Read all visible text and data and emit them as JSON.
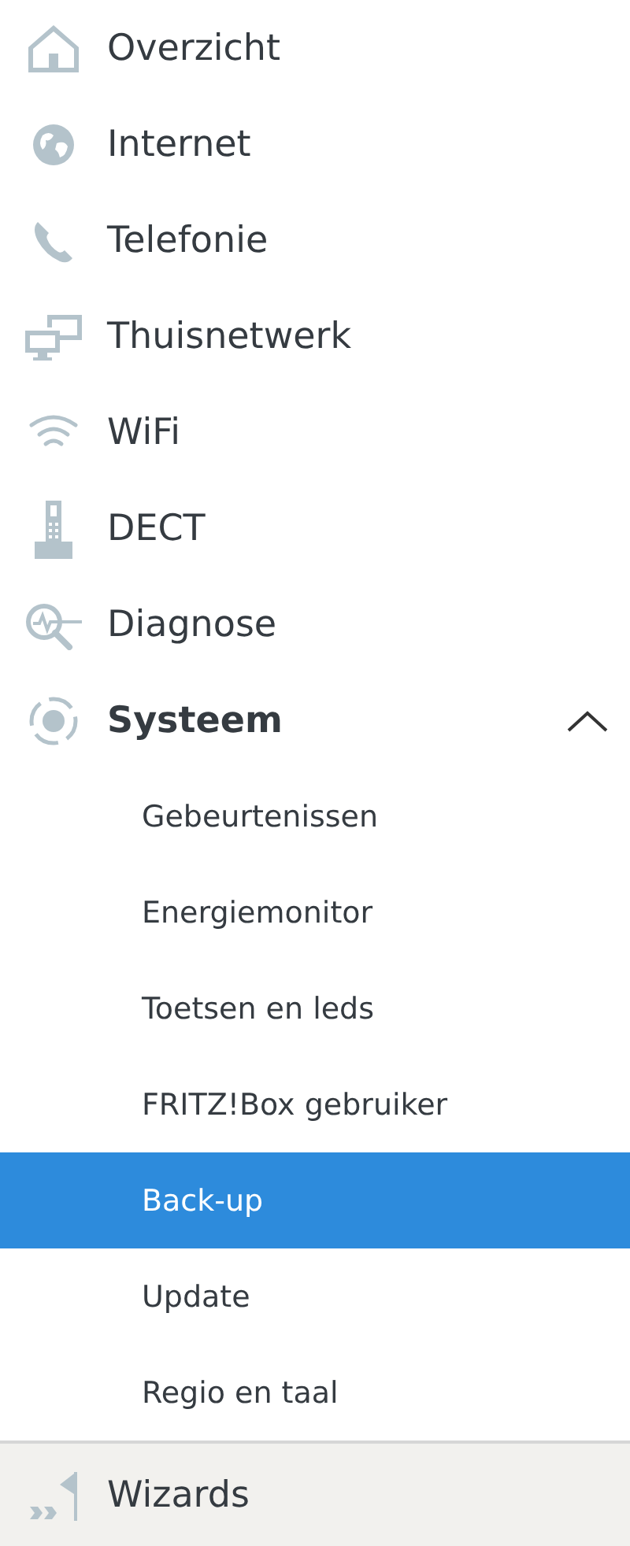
{
  "menu": [
    {
      "label": "Overzicht",
      "selected": false
    },
    {
      "label": "Internet",
      "selected": false
    },
    {
      "label": "Telefonie",
      "selected": false
    },
    {
      "label": "Thuisnetwerk",
      "selected": false
    },
    {
      "label": "WiFi",
      "selected": false
    },
    {
      "label": "DECT",
      "selected": false
    },
    {
      "label": "Diagnose",
      "selected": false
    },
    {
      "label": "Systeem",
      "selected": false,
      "expanded": true,
      "children": [
        {
          "label": "Gebeurtenissen",
          "selected": false
        },
        {
          "label": "Energiemonitor",
          "selected": false
        },
        {
          "label": "Toetsen en leds",
          "selected": false
        },
        {
          "label": "FRITZ!Box gebruiker",
          "selected": false
        },
        {
          "label": "Back-up",
          "selected": true
        },
        {
          "label": "Update",
          "selected": false
        },
        {
          "label": "Regio en taal",
          "selected": false
        }
      ]
    }
  ],
  "footer": {
    "label": "Wizards"
  }
}
